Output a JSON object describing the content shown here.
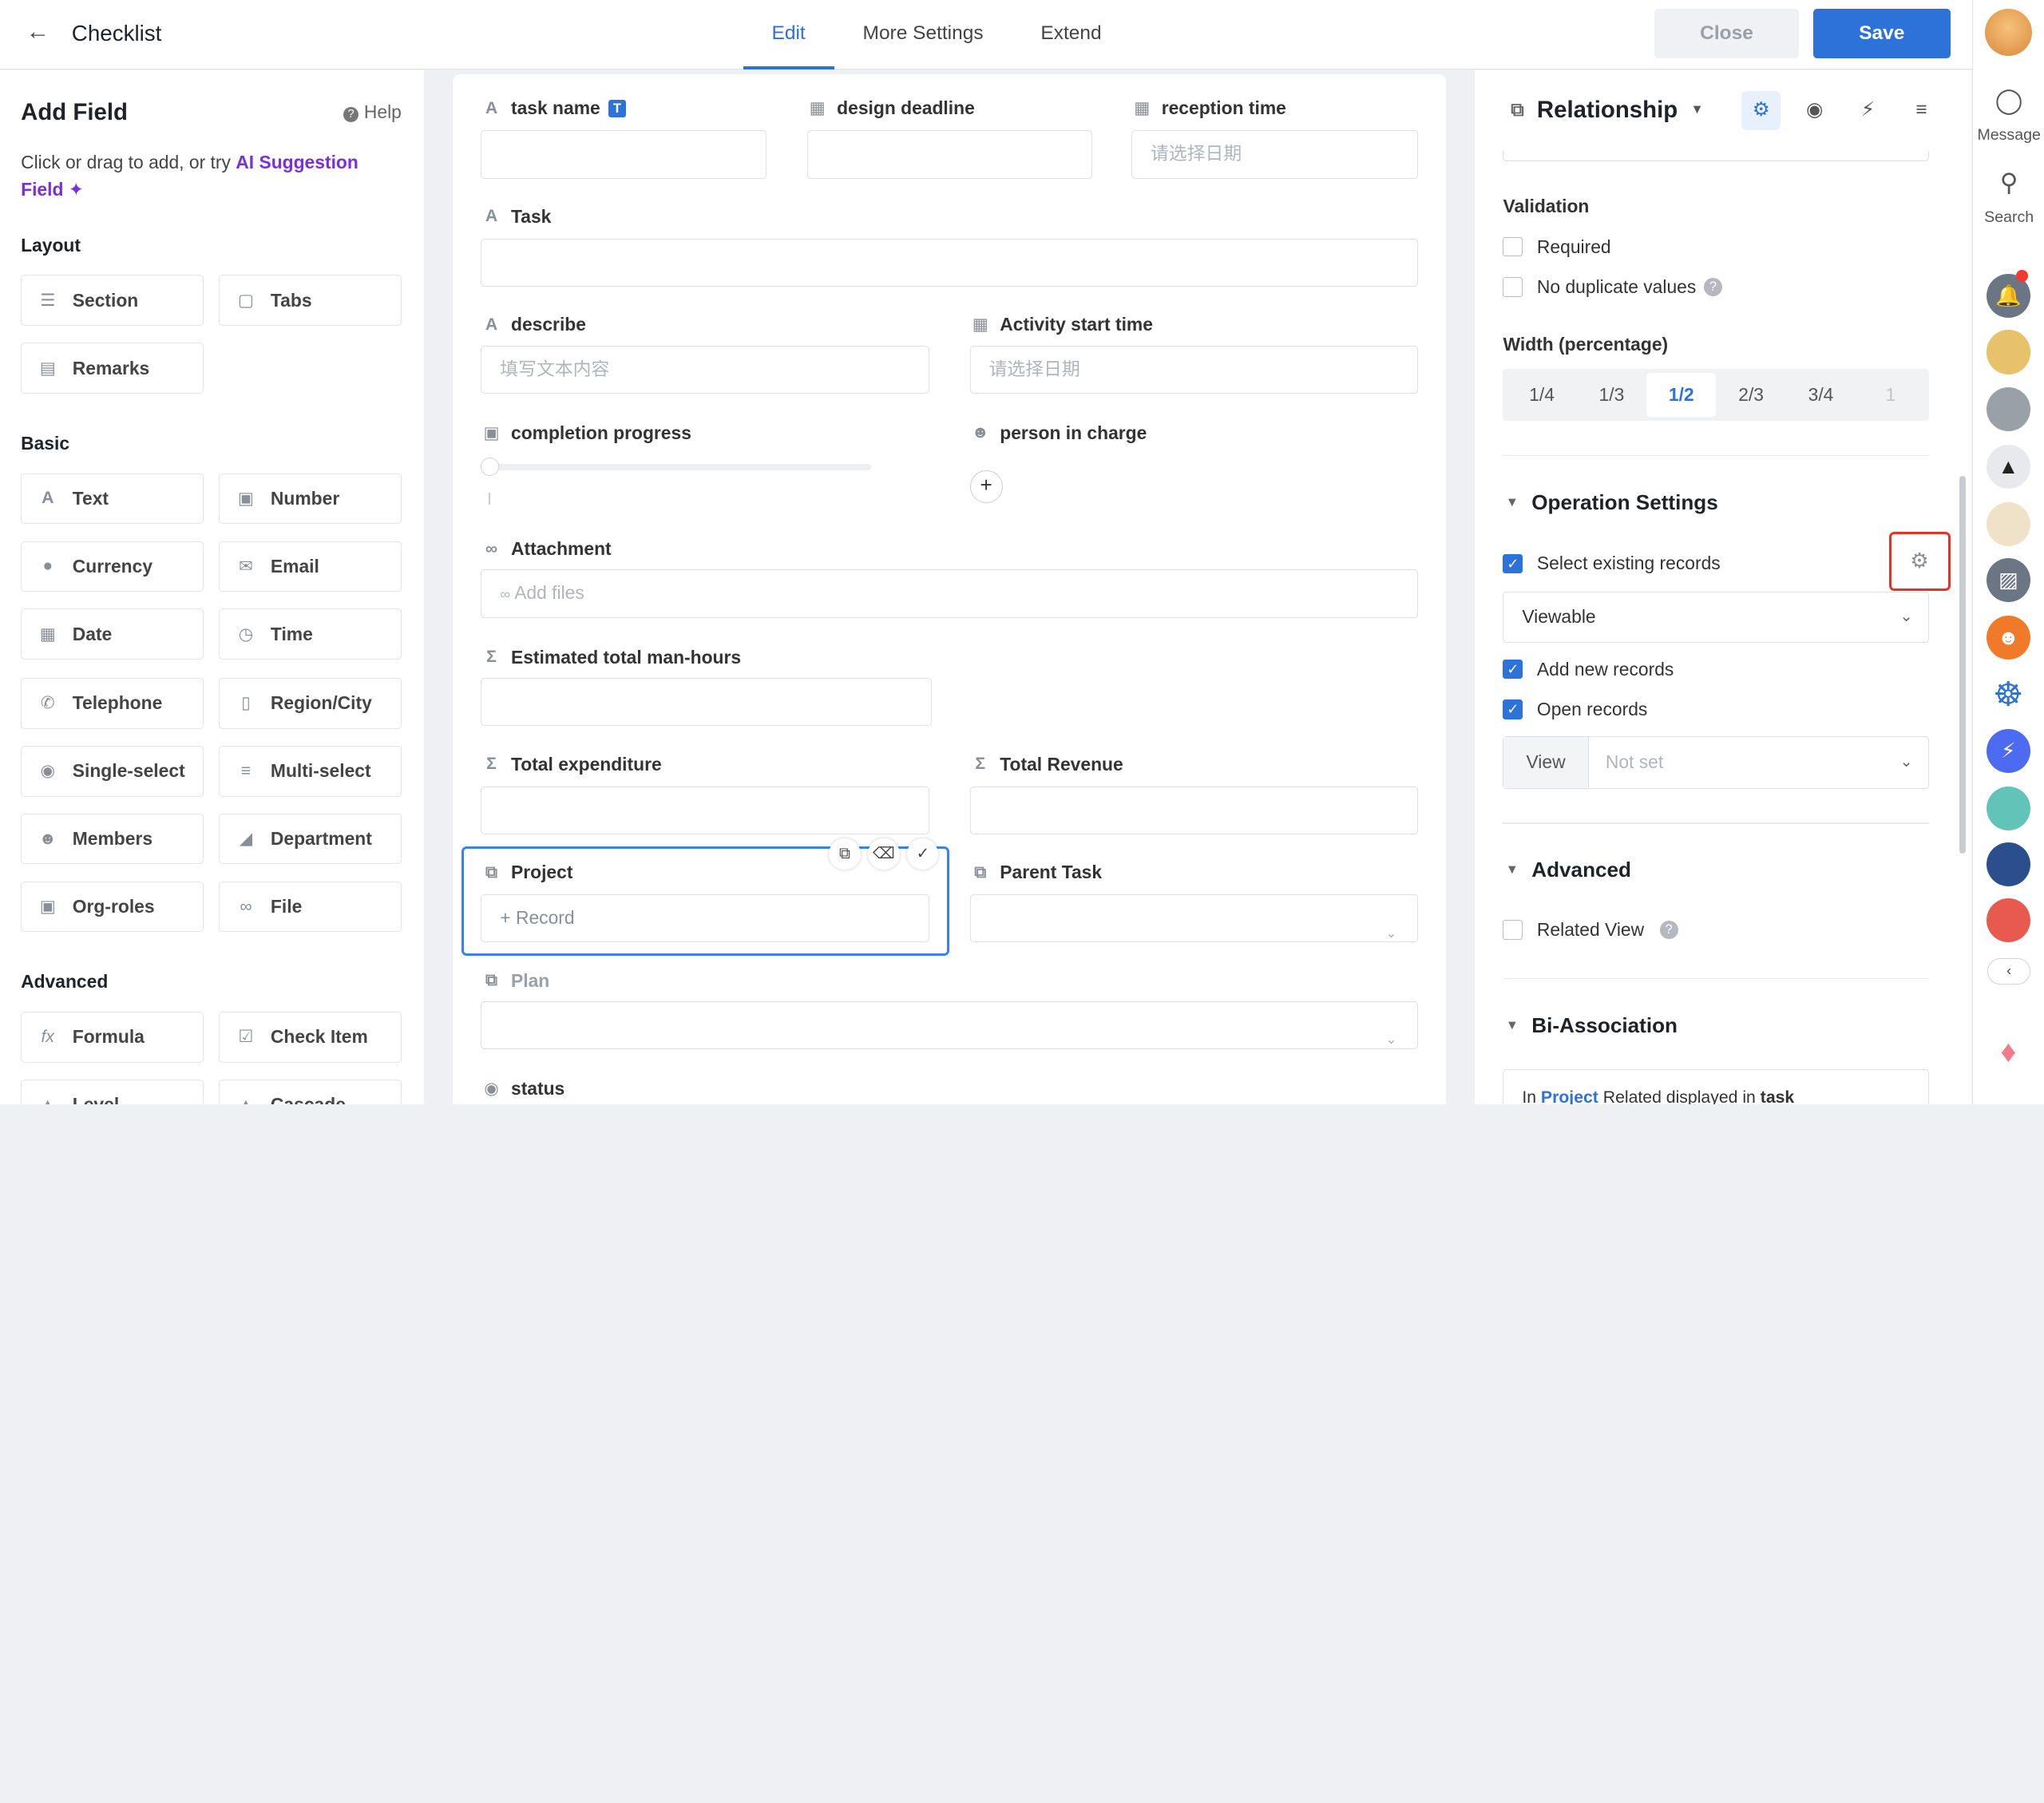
{
  "topbar": {
    "title": "Checklist",
    "tabs": [
      "Edit",
      "More Settings",
      "Extend"
    ],
    "active_tab": "Edit",
    "close_label": "Close",
    "save_label": "Save",
    "accent": "#2d72d9"
  },
  "left": {
    "heading": "Add Field",
    "help": "Help",
    "hint_prefix": "Click or drag to add, or try ",
    "hint_link": "AI Suggestion Field",
    "groups": {
      "layout": "Layout",
      "basic": "Basic",
      "advanced": "Advanced"
    },
    "layout_fields": [
      {
        "label": "Section",
        "icon": "section-icon"
      },
      {
        "label": "Tabs",
        "icon": "tabs-icon"
      },
      {
        "label": "Remarks",
        "icon": "remarks-icon"
      }
    ],
    "basic_fields": [
      {
        "label": "Text",
        "icon": "text-icon"
      },
      {
        "label": "Number",
        "icon": "number-icon"
      },
      {
        "label": "Currency",
        "icon": "currency-icon"
      },
      {
        "label": "Email",
        "icon": "email-icon"
      },
      {
        "label": "Date",
        "icon": "date-icon"
      },
      {
        "label": "Time",
        "icon": "time-icon"
      },
      {
        "label": "Telephone",
        "icon": "telephone-icon"
      },
      {
        "label": "Region/City",
        "icon": "region-icon"
      },
      {
        "label": "Single-select",
        "icon": "single-select-icon"
      },
      {
        "label": "Multi-select",
        "icon": "multi-select-icon"
      },
      {
        "label": "Members",
        "icon": "members-icon"
      },
      {
        "label": "Department",
        "icon": "department-icon"
      },
      {
        "label": "Org-roles",
        "icon": "org-roles-icon"
      },
      {
        "label": "File",
        "icon": "file-icon"
      }
    ],
    "advanced_fields": [
      {
        "label": "Formula",
        "icon": "formula-icon"
      },
      {
        "label": "Check Item",
        "icon": "check-item-icon"
      },
      {
        "label": "Level",
        "icon": "level-icon"
      },
      {
        "label": "Cascade",
        "icon": "cascade-icon"
      }
    ]
  },
  "form": {
    "task_name": {
      "label": "task name",
      "badge": "T"
    },
    "design_deadline": {
      "label": "design deadline"
    },
    "reception_time": {
      "label": "reception time",
      "placeholder": "请选择日期"
    },
    "task": {
      "label": "Task"
    },
    "describe": {
      "label": "describe",
      "placeholder": "填写文本内容"
    },
    "activity_start": {
      "label": "Activity start time",
      "placeholder": "请选择日期"
    },
    "completion": {
      "label": "completion progress",
      "progress": 0
    },
    "person": {
      "label": "person in charge"
    },
    "attachment": {
      "label": "Attachment",
      "placeholder": "Add files"
    },
    "est_hours": {
      "label": "Estimated total man-hours"
    },
    "total_exp": {
      "label": "Total expenditure"
    },
    "total_rev": {
      "label": "Total Revenue"
    },
    "project": {
      "label": "Project",
      "placeholder": "+ Record"
    },
    "parent_task": {
      "label": "Parent Task"
    },
    "plan": {
      "label": "Plan"
    },
    "status": {
      "label": "status"
    }
  },
  "props": {
    "title": "Relationship",
    "validation": "Validation",
    "required": "Required",
    "no_dup": "No duplicate values",
    "width_title": "Width (percentage)",
    "widths": [
      "1/4",
      "1/3",
      "1/2",
      "2/3",
      "3/4",
      "1"
    ],
    "width_selected": "1/2",
    "operation": "Operation Settings",
    "select_existing": "Select existing records",
    "viewable": "Viewable",
    "add_new": "Add new records",
    "open_records": "Open records",
    "view_label": "View",
    "view_value": "Not set",
    "advanced": "Advanced",
    "related_view": "Related View",
    "bi": "Bi-Association",
    "bi_prefix": "In ",
    "bi_link": "Project",
    "bi_mid": " Related displayed in ",
    "bi_end": "task"
  },
  "dock": {
    "message": "Message",
    "search": "Search"
  }
}
